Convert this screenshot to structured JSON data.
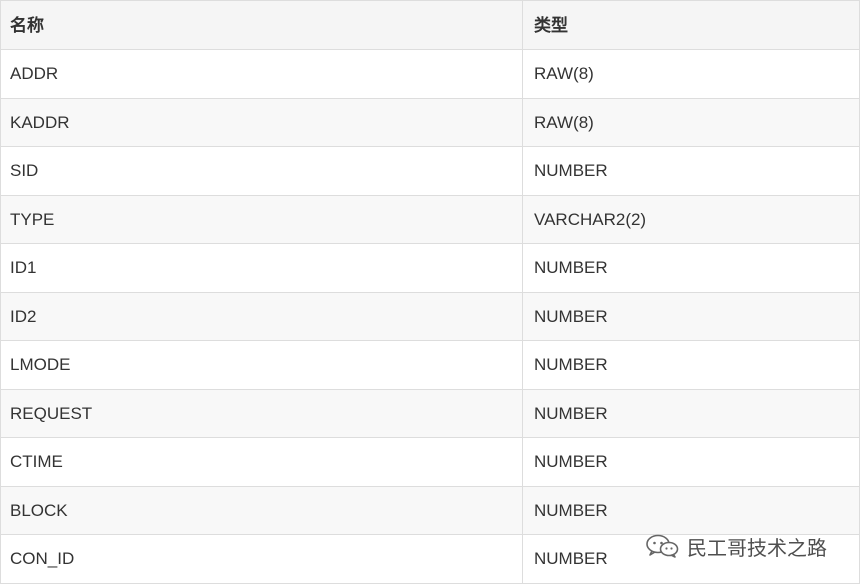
{
  "table": {
    "headers": {
      "name": "名称",
      "type": "类型"
    },
    "rows": [
      {
        "name": "ADDR",
        "type": "RAW(8)"
      },
      {
        "name": "KADDR",
        "type": "RAW(8)"
      },
      {
        "name": "SID",
        "type": "NUMBER"
      },
      {
        "name": "TYPE",
        "type": "VARCHAR2(2)"
      },
      {
        "name": "ID1",
        "type": "NUMBER"
      },
      {
        "name": "ID2",
        "type": "NUMBER"
      },
      {
        "name": "LMODE",
        "type": "NUMBER"
      },
      {
        "name": "REQUEST",
        "type": "NUMBER"
      },
      {
        "name": "CTIME",
        "type": "NUMBER"
      },
      {
        "name": "BLOCK",
        "type": "NUMBER"
      },
      {
        "name": "CON_ID",
        "type": "NUMBER"
      }
    ]
  },
  "watermark": {
    "text": "民工哥技术之路",
    "icon": "wechat-icon"
  },
  "colors": {
    "border": "#dddddd",
    "header_bg": "#f5f5f5",
    "alt_row_bg": "#f8f8f8",
    "text": "#333333"
  }
}
